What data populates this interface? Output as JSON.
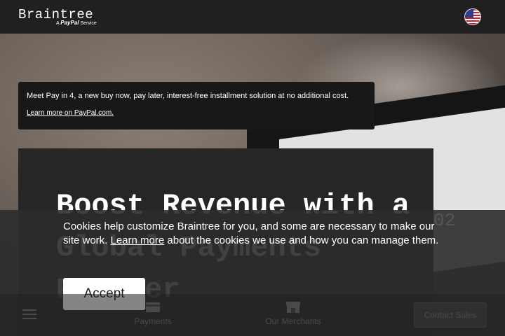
{
  "header": {
    "brand": "Braintree",
    "brand_sub_prefix": "A",
    "brand_sub_paypal": "PayPal",
    "brand_sub_suffix": "Service",
    "flag_icon": "us-flag-icon"
  },
  "notice": {
    "text": "Meet Pay in 4, a new buy now, pay later, interest-free installment solution at no additional cost.",
    "link": "Learn more on PayPal.com",
    "link_suffix": "."
  },
  "hero": {
    "headline": "Boost Revenue with a Global Payments Partner"
  },
  "cookie": {
    "text_before": "Cookies help customize Braintree for you, and some are necessary to make our site work. ",
    "link": "Learn more",
    "text_after": " about the cookies we use and how you can manage them.",
    "accept": "Accept",
    "ghost": "02"
  },
  "bottom_nav": {
    "menu_icon": "hamburger-icon",
    "items": [
      {
        "label": "Payments",
        "icon": "card-icon"
      },
      {
        "label": "Our Merchants",
        "icon": "storefront-icon"
      }
    ],
    "contact": "Contact Sales"
  }
}
